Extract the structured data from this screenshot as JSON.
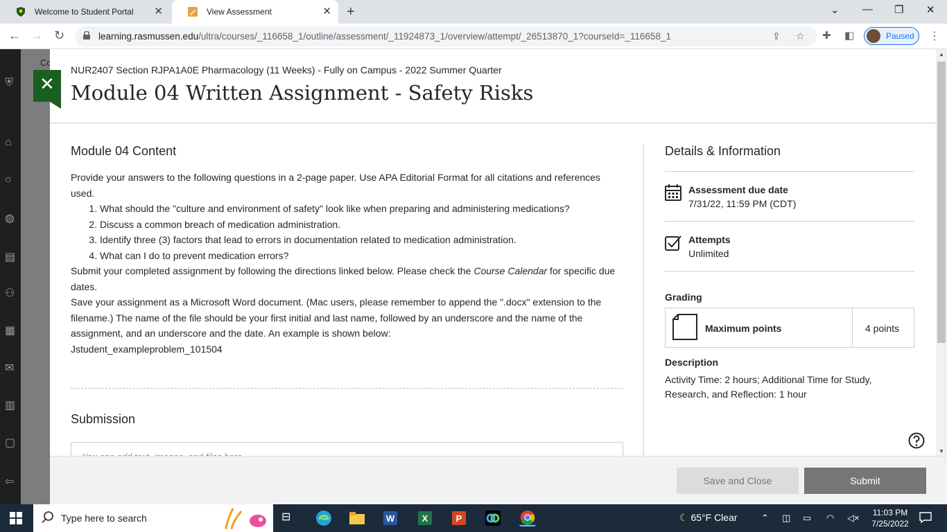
{
  "browser": {
    "tabs": [
      {
        "label": "Welcome to Student Portal"
      },
      {
        "label": "View Assessment"
      }
    ],
    "url_host": "learning.rasmussen.edu",
    "url_path": "/ultra/courses/_116658_1/outline/assessment/_11924873_1/overview/attempt/_26513870_1?courseId=_116658_1",
    "profile_label": "Paused"
  },
  "background_app": {
    "partial_text": "Co"
  },
  "assessment": {
    "course": "NUR2407 Section RJPA1A0E Pharmacology (11 Weeks) - Fully on Campus - 2022 Summer Quarter",
    "title": "Module 04 Written Assignment - Safety Risks",
    "content_heading": "Module 04 Content",
    "intro": "Provide your answers to the following questions in a 2-page paper. Use APA Editorial Format for all citations and references used.",
    "questions": [
      "What should the \"culture and environment of safety\" look like when preparing and administering medications?",
      "Discuss a common breach of medication administration.",
      "Identify three (3) factors that lead to errors in documentation related to medication administration.",
      "What can I do to prevent medication errors?"
    ],
    "submit_pre": "Submit your completed assignment by following the directions linked below. Please check the ",
    "submit_em": "Course Calendar",
    "submit_post": " for specific due dates.",
    "save_text": "Save your assignment as a Microsoft Word document. (Mac users, please remember to append the \".docx\" extension to the filename.) The name of the file should be your first initial and last name, followed by an underscore and the name of the assignment, and an underscore and the date. An example is shown below:",
    "example": "Jstudent_exampleproblem_101504",
    "submission_heading": "Submission",
    "editor_placeholder": "You can add text, images, and files here"
  },
  "details": {
    "heading": "Details & Information",
    "due_label": "Assessment due date",
    "due_value": "7/31/22, 11:59 PM (CDT)",
    "attempts_label": "Attempts",
    "attempts_value": "Unlimited",
    "grading_label": "Grading",
    "max_points_label": "Maximum points",
    "max_points_value": "4 points",
    "description_label": "Description",
    "description": "Activity Time: 2 hours; Additional Time for Study, Research, and Reflection: 1 hour"
  },
  "footer": {
    "save_label": "Save and Close",
    "submit_label": "Submit"
  },
  "taskbar": {
    "search_placeholder": "Type here to search",
    "weather": "65°F  Clear",
    "time": "11:03 PM",
    "date": "7/25/2022"
  },
  "colors": {
    "accent_green": "#1b5e20",
    "link_blue": "#1a73e8",
    "submit_gray": "#767676"
  }
}
